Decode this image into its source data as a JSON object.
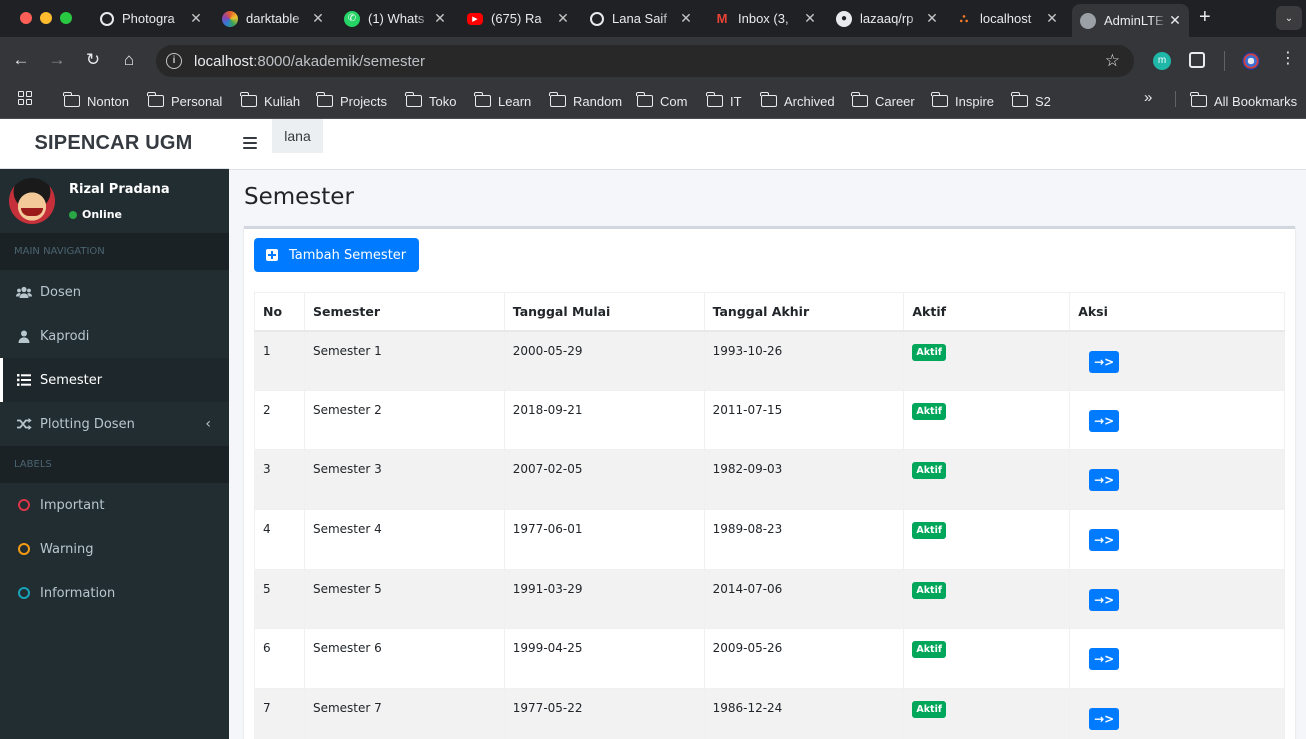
{
  "browser": {
    "tabs": [
      {
        "title": "Photogra",
        "favicon": "aperture-icon",
        "color": "#e8eaed"
      },
      {
        "title": "darktable",
        "favicon": "darktable-icon",
        "color": "#e25a2c"
      },
      {
        "title": "(1) Whats",
        "favicon": "whatsapp-icon",
        "color": "#25d366"
      },
      {
        "title": "(675) Ra",
        "favicon": "youtube-icon",
        "color": "#ff0000"
      },
      {
        "title": "Lana Saif",
        "favicon": "globe-icon",
        "color": "#e8eaed"
      },
      {
        "title": "Inbox (3,",
        "favicon": "gmail-icon",
        "color": "#ea4335"
      },
      {
        "title": "lazaaq/rp",
        "favicon": "github-icon",
        "color": "#e8eaed"
      },
      {
        "title": "localhost",
        "favicon": "xampp-icon",
        "color": "#fb7a24"
      },
      {
        "title": "AdminLTE",
        "favicon": "globe-icon",
        "color": "#9aa0a6",
        "active": true
      }
    ],
    "url_host": "localhost",
    "url_path": ":8000/akademik/semester",
    "bookmarks": [
      "Nonton",
      "Personal",
      "Kuliah",
      "Projects",
      "Toko",
      "Learn",
      "Random",
      "Com",
      "IT",
      "Archived",
      "Career",
      "Inspire",
      "S2"
    ],
    "all_bookmarks": "All Bookmarks"
  },
  "app": {
    "brand": "SIPENCAR UGM",
    "top_user_tab": "lana",
    "user": {
      "name": "Rizal Pradana",
      "status": "Online"
    },
    "nav_header": "MAIN NAVIGATION",
    "nav": [
      {
        "label": "Dosen",
        "icon": "users-icon"
      },
      {
        "label": "Kaprodi",
        "icon": "user-icon"
      },
      {
        "label": "Semester",
        "icon": "list-icon",
        "active": true
      },
      {
        "label": "Plotting Dosen",
        "icon": "random-icon"
      }
    ],
    "labels_header": "LABELS",
    "labels": [
      {
        "label": "Important",
        "color": "#dc3545"
      },
      {
        "label": "Warning",
        "color": "#f39c12"
      },
      {
        "label": "Information",
        "color": "#17a2b8"
      }
    ]
  },
  "main": {
    "title": "Semester",
    "add_button": "Tambah Semester",
    "table": {
      "headers": [
        "No",
        "Semester",
        "Tanggal Mulai",
        "Tanggal Akhir",
        "Aktif",
        "Aksi"
      ],
      "rows": [
        {
          "no": "1",
          "semester": "Semester 1",
          "mulai": "2000-05-29",
          "akhir": "1993-10-26",
          "aktif": "Aktif"
        },
        {
          "no": "2",
          "semester": "Semester 2",
          "mulai": "2018-09-21",
          "akhir": "2011-07-15",
          "aktif": "Aktif"
        },
        {
          "no": "3",
          "semester": "Semester 3",
          "mulai": "2007-02-05",
          "akhir": "1982-09-03",
          "aktif": "Aktif"
        },
        {
          "no": "4",
          "semester": "Semester 4",
          "mulai": "1977-06-01",
          "akhir": "1989-08-23",
          "aktif": "Aktif"
        },
        {
          "no": "5",
          "semester": "Semester 5",
          "mulai": "1991-03-29",
          "akhir": "2014-07-06",
          "aktif": "Aktif"
        },
        {
          "no": "6",
          "semester": "Semester 6",
          "mulai": "1999-04-25",
          "akhir": "2009-05-26",
          "aktif": "Aktif"
        },
        {
          "no": "7",
          "semester": "Semester 7",
          "mulai": "1977-05-22",
          "akhir": "1986-12-24",
          "aktif": "Aktif"
        }
      ]
    }
  }
}
